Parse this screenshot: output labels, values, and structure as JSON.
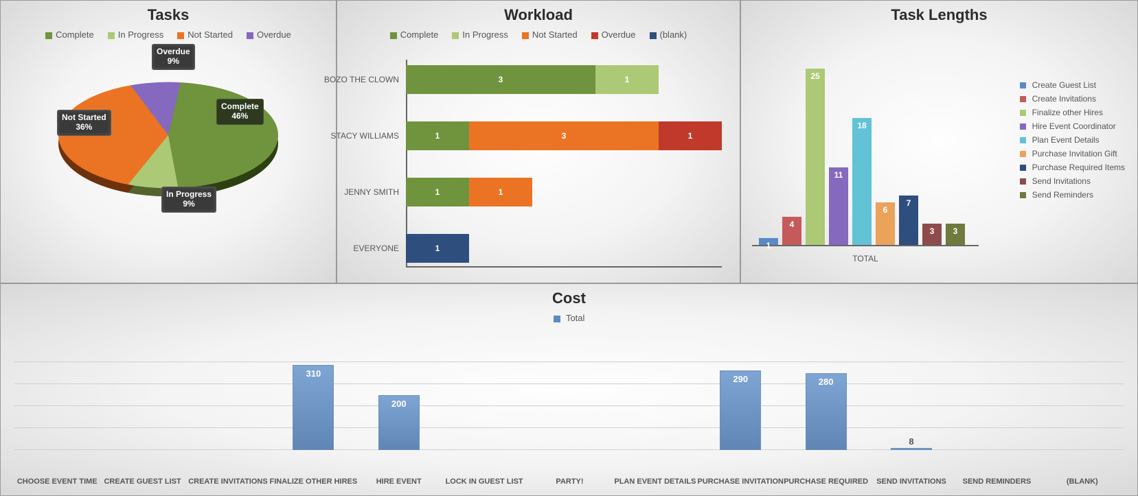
{
  "tasks": {
    "title": "Tasks",
    "legend": [
      {
        "label": "Complete",
        "color": "#70933d"
      },
      {
        "label": "In Progress",
        "color": "#acc975"
      },
      {
        "label": "Not Started",
        "color": "#ea7424"
      },
      {
        "label": "Overdue",
        "color": "#8569bf"
      }
    ],
    "labels": {
      "overdue": "Overdue",
      "overdue_pct": "9%",
      "complete": "Complete",
      "complete_pct": "46%",
      "inprogress": "In Progress",
      "inprogress_pct": "9%",
      "notstarted": "Not Started",
      "notstarted_pct": "36%"
    }
  },
  "workload": {
    "title": "Workload",
    "legend": [
      {
        "label": "Complete",
        "color": "#70933d"
      },
      {
        "label": "In Progress",
        "color": "#acc975"
      },
      {
        "label": "Not Started",
        "color": "#ea7424"
      },
      {
        "label": "Overdue",
        "color": "#c0392b"
      },
      {
        "label": "(blank)",
        "color": "#2e4e7e"
      }
    ],
    "rows": [
      {
        "name": "BOZO THE CLOWN",
        "segments": [
          {
            "key": "Complete",
            "value": 3,
            "color": "#70933d"
          },
          {
            "key": "In Progress",
            "value": 1,
            "color": "#acc975"
          }
        ]
      },
      {
        "name": "STACY WILLIAMS",
        "segments": [
          {
            "key": "Complete",
            "value": 1,
            "color": "#70933d"
          },
          {
            "key": "Not Started",
            "value": 3,
            "color": "#ea7424"
          },
          {
            "key": "Overdue",
            "value": 1,
            "color": "#c0392b"
          }
        ]
      },
      {
        "name": "JENNY SMITH",
        "segments": [
          {
            "key": "Complete",
            "value": 1,
            "color": "#70933d"
          },
          {
            "key": "Not Started",
            "value": 1,
            "color": "#ea7424"
          }
        ]
      },
      {
        "name": "EVERYONE",
        "segments": [
          {
            "key": "(blank)",
            "value": 1,
            "color": "#2e4e7e"
          }
        ]
      }
    ],
    "x_max": 5
  },
  "lengths": {
    "title": "Task Lengths",
    "xlabel": "TOTAL",
    "bars": [
      {
        "label": "Create Guest List",
        "value": 1,
        "color": "#5a8ac6"
      },
      {
        "label": "Create Invitations",
        "value": 4,
        "color": "#c65a5a"
      },
      {
        "label": "Finalize other Hires",
        "value": 25,
        "color": "#acc975"
      },
      {
        "label": "Hire Event Coordinator",
        "value": 11,
        "color": "#8569bf"
      },
      {
        "label": "Plan Event Details",
        "value": 18,
        "color": "#62c2d6"
      },
      {
        "label": "Purchase Invitation Gift",
        "value": 6,
        "color": "#eba25a"
      },
      {
        "label": "Purchase Required Items",
        "value": 7,
        "color": "#2e4e7e"
      },
      {
        "label": "Send Invitations",
        "value": 3,
        "color": "#8f4b4b"
      },
      {
        "label": "Send Reminders",
        "value": 3,
        "color": "#6f7a3d"
      }
    ],
    "y_max": 28
  },
  "cost": {
    "title": "Cost",
    "legend_label": "Total",
    "legend_color": "#5a8ac6",
    "categories": [
      "CHOOSE EVENT TIME",
      "CREATE GUEST LIST",
      "CREATE INVITATIONS",
      "FINALIZE OTHER HIRES",
      "HIRE EVENT",
      "LOCK IN GUEST LIST",
      "PARTY!",
      "PLAN EVENT DETAILS",
      "PURCHASE INVITATION",
      "PURCHASE REQUIRED",
      "SEND INVITATIONS",
      "SEND REMINDERS",
      "(BLANK)"
    ],
    "values": [
      0,
      0,
      0,
      310,
      200,
      0,
      0,
      0,
      290,
      280,
      8,
      0,
      0
    ],
    "y_max": 350
  },
  "chart_data": [
    {
      "type": "pie",
      "title": "Tasks",
      "categories": [
        "Complete",
        "In Progress",
        "Not Started",
        "Overdue"
      ],
      "values": [
        46,
        9,
        36,
        9
      ],
      "unit": "percent"
    },
    {
      "type": "bar",
      "orientation": "horizontal",
      "stacked": true,
      "title": "Workload",
      "categories": [
        "BOZO THE CLOWN",
        "STACY WILLIAMS",
        "JENNY SMITH",
        "EVERYONE"
      ],
      "series": [
        {
          "name": "Complete",
          "values": [
            3,
            1,
            1,
            0
          ]
        },
        {
          "name": "In Progress",
          "values": [
            1,
            0,
            0,
            0
          ]
        },
        {
          "name": "Not Started",
          "values": [
            0,
            3,
            1,
            0
          ]
        },
        {
          "name": "Overdue",
          "values": [
            0,
            1,
            0,
            0
          ]
        },
        {
          "name": "(blank)",
          "values": [
            0,
            0,
            0,
            1
          ]
        }
      ],
      "xlabel": "",
      "ylabel": ""
    },
    {
      "type": "bar",
      "title": "Task Lengths",
      "categories": [
        "Create Guest List",
        "Create Invitations",
        "Finalize other Hires",
        "Hire Event Coordinator",
        "Plan Event Details",
        "Purchase Invitation Gift",
        "Purchase Required Items",
        "Send Invitations",
        "Send Reminders"
      ],
      "values": [
        1,
        4,
        25,
        11,
        18,
        6,
        7,
        3,
        3
      ],
      "xlabel": "TOTAL",
      "ylabel": "",
      "ylim": [
        0,
        28
      ]
    },
    {
      "type": "bar",
      "title": "Cost",
      "categories": [
        "CHOOSE EVENT TIME",
        "CREATE GUEST LIST",
        "CREATE INVITATIONS",
        "FINALIZE OTHER HIRES",
        "HIRE EVENT",
        "LOCK IN GUEST LIST",
        "PARTY!",
        "PLAN EVENT DETAILS",
        "PURCHASE INVITATION",
        "PURCHASE REQUIRED",
        "SEND INVITATIONS",
        "SEND REMINDERS",
        "(BLANK)"
      ],
      "series": [
        {
          "name": "Total",
          "values": [
            0,
            0,
            0,
            310,
            200,
            0,
            0,
            0,
            290,
            280,
            8,
            0,
            0
          ]
        }
      ],
      "xlabel": "",
      "ylabel": "",
      "ylim": [
        0,
        350
      ]
    }
  ]
}
